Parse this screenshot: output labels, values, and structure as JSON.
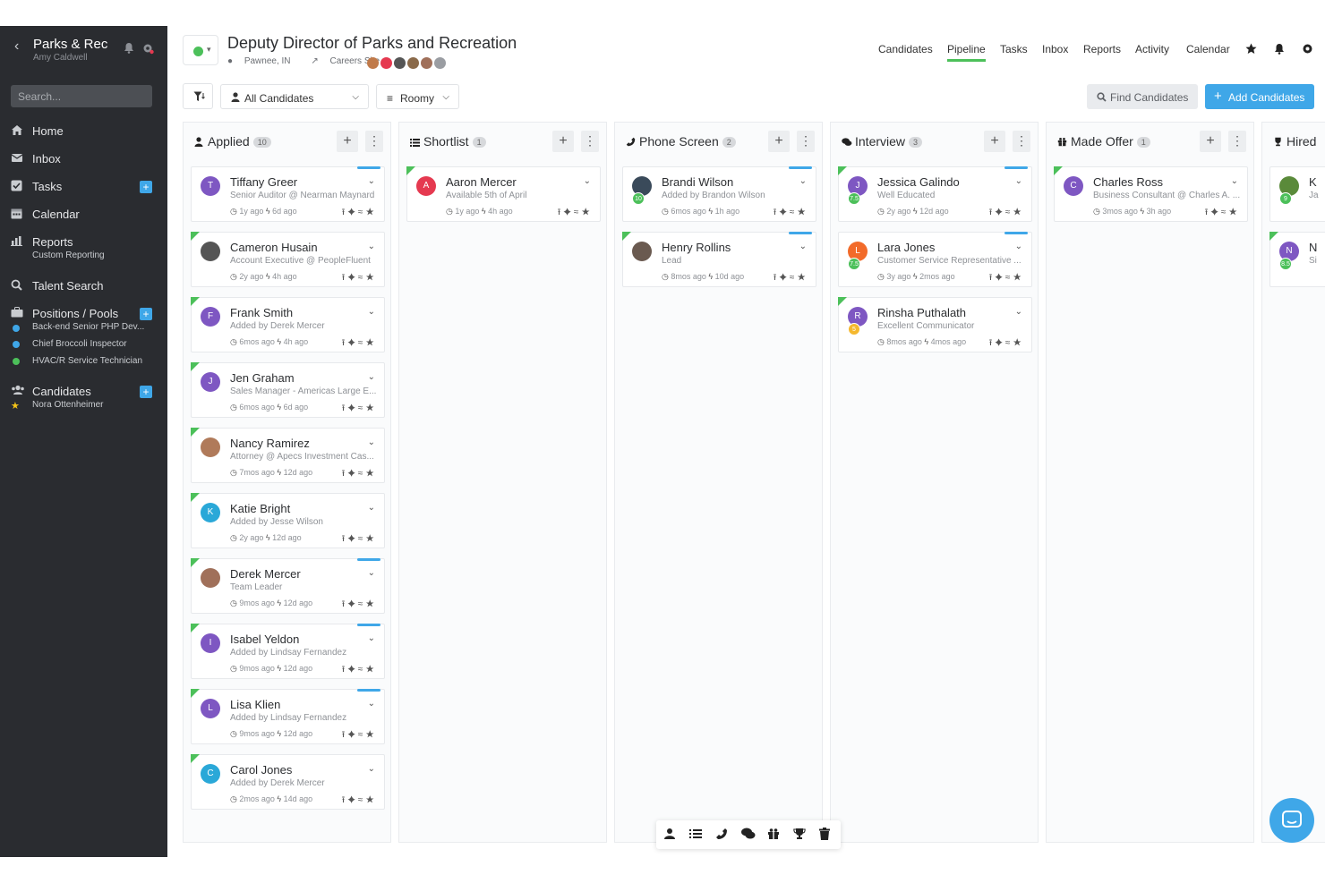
{
  "sidebar": {
    "org_name": "Parks & Rec",
    "user_name": "Amy Caldwell",
    "search_placeholder": "Search...",
    "items": [
      {
        "label": "Home",
        "icon": "home-icon"
      },
      {
        "label": "Inbox",
        "icon": "inbox-icon"
      },
      {
        "label": "Tasks",
        "icon": "tasks-icon"
      },
      {
        "label": "Calendar",
        "icon": "calendar-icon"
      },
      {
        "label": "Reports",
        "icon": "reports-icon"
      },
      {
        "label": "Talent Search",
        "icon": "search-icon"
      },
      {
        "label": "Positions / Pools",
        "icon": "briefcase-icon"
      },
      {
        "label": "Candidates",
        "icon": "users-icon"
      }
    ],
    "reports_sub": "Custom Reporting",
    "positions": [
      {
        "label": "Back-end Senior PHP Dev...",
        "color": "#3fa7e8"
      },
      {
        "label": "Chief Broccoli Inspector",
        "color": "#3fa7e8"
      },
      {
        "label": "HVAC/R Service Technician",
        "color": "#4cc05a"
      }
    ],
    "candidates_sub": "Nora Ottenheimer",
    "plus": "+"
  },
  "header": {
    "title": "Deputy Director of Parks and Recreation",
    "location": "Pawnee, IN",
    "careers_site": "Careers Site",
    "status_color": "#4cc05a",
    "nav": [
      "Candidates",
      "Pipeline",
      "Tasks",
      "Inbox",
      "Reports",
      "Activity",
      "Calendar"
    ],
    "active_nav": "Pipeline"
  },
  "toolbar": {
    "candidates_filter": "All Candidates",
    "view_mode": "Roomy",
    "find_label": "Find Candidates",
    "add_label": "Add Candidates"
  },
  "columns": [
    {
      "name": "Applied",
      "count": "10",
      "icon": "user-icon",
      "cards": [
        {
          "name": "Tiffany Greer",
          "sub": "Senior Auditor @ Nearman Maynard",
          "t1": "1y ago",
          "t2": "6d ago",
          "initial": "T",
          "color": "#7e57c2",
          "flag": false,
          "bar": true
        },
        {
          "name": "Cameron Husain",
          "sub": "Account Executive @ PeopleFluent",
          "t1": "2y ago",
          "t2": "4h ago",
          "initial": "",
          "color": "#555",
          "flag": true,
          "bar": false
        },
        {
          "name": "Frank Smith",
          "sub": "Added by Derek Mercer",
          "t1": "6mos ago",
          "t2": "4h ago",
          "initial": "F",
          "color": "#7e57c2",
          "flag": true,
          "bar": false
        },
        {
          "name": "Jen Graham",
          "sub": "Sales Manager - Americas Large E...",
          "t1": "6mos ago",
          "t2": "6d ago",
          "initial": "J",
          "color": "#7e57c2",
          "flag": true,
          "bar": false
        },
        {
          "name": "Nancy Ramirez",
          "sub": "Attorney @ Apecs Investment Cas...",
          "t1": "7mos ago",
          "t2": "12d ago",
          "initial": "",
          "color": "#b07a5a",
          "flag": true,
          "bar": false
        },
        {
          "name": "Katie Bright",
          "sub": "Added by Jesse Wilson",
          "t1": "2y ago",
          "t2": "12d ago",
          "initial": "K",
          "color": "#2aa8d8",
          "flag": true,
          "bar": false
        },
        {
          "name": "Derek Mercer",
          "sub": "Team Leader",
          "t1": "9mos ago",
          "t2": "12d ago",
          "initial": "",
          "color": "#a0705a",
          "flag": true,
          "bar": true
        },
        {
          "name": "Isabel Yeldon",
          "sub": "Added by Lindsay Fernandez",
          "t1": "9mos ago",
          "t2": "12d ago",
          "initial": "I",
          "color": "#7e57c2",
          "flag": true,
          "bar": true
        },
        {
          "name": "Lisa Klien",
          "sub": "Added by Lindsay Fernandez",
          "t1": "9mos ago",
          "t2": "12d ago",
          "initial": "L",
          "color": "#7e57c2",
          "flag": true,
          "bar": true
        },
        {
          "name": "Carol Jones",
          "sub": "Added by Derek Mercer",
          "t1": "2mos ago",
          "t2": "14d ago",
          "initial": "C",
          "color": "#2aa8d8",
          "flag": true,
          "bar": false
        }
      ]
    },
    {
      "name": "Shortlist",
      "count": "1",
      "icon": "list-icon",
      "cards": [
        {
          "name": "Aaron Mercer",
          "sub": "Available 5th of April",
          "t1": "1y ago",
          "t2": "4h ago",
          "initial": "A",
          "color": "#e53950",
          "flag": true,
          "bar": false
        }
      ]
    },
    {
      "name": "Phone Screen",
      "count": "2",
      "icon": "phone-icon",
      "cards": [
        {
          "name": "Brandi Wilson",
          "sub": "Added by Brandon Wilson",
          "t1": "6mos ago",
          "t2": "1h ago",
          "initial": "",
          "color": "#3a4a5a",
          "flag": false,
          "bar": true,
          "score": "10"
        },
        {
          "name": "Henry Rollins",
          "sub": "Lead",
          "t1": "8mos ago",
          "t2": "10d ago",
          "initial": "",
          "color": "#6a5a50",
          "flag": true,
          "bar": true
        }
      ]
    },
    {
      "name": "Interview",
      "count": "3",
      "icon": "comments-icon",
      "cards": [
        {
          "name": "Jessica Galindo",
          "sub": "Well Educated",
          "t1": "2y ago",
          "t2": "12d ago",
          "initial": "J",
          "color": "#7e57c2",
          "flag": true,
          "bar": true,
          "score": "7.5"
        },
        {
          "name": "Lara Jones",
          "sub": "Customer Service Representative ...",
          "t1": "3y ago",
          "t2": "2mos ago",
          "initial": "L",
          "color": "#f26b2a",
          "flag": false,
          "bar": true,
          "score": "7.5"
        },
        {
          "name": "Rinsha Puthalath",
          "sub": "Excellent Communicator",
          "t1": "8mos ago",
          "t2": "4mos ago",
          "initial": "R",
          "color": "#7e57c2",
          "flag": true,
          "bar": false,
          "score": "5"
        }
      ]
    },
    {
      "name": "Made Offer",
      "count": "1",
      "icon": "gift-icon",
      "cards": [
        {
          "name": "Charles Ross",
          "sub": "Business Consultant @ Charles A. ...",
          "t1": "3mos ago",
          "t2": "3h ago",
          "initial": "C",
          "color": "#7e57c2",
          "flag": true,
          "bar": false
        }
      ]
    },
    {
      "name": "Hired",
      "count": "",
      "icon": "trophy-icon",
      "cards": [
        {
          "name": "K",
          "sub": "Ja",
          "t1": "",
          "t2": "",
          "initial": "",
          "color": "#5a8a3a",
          "flag": false,
          "bar": false,
          "score": "9"
        },
        {
          "name": "N",
          "sub": "Si",
          "t1": "",
          "t2": "",
          "initial": "N",
          "color": "#7e57c2",
          "flag": true,
          "bar": false,
          "score": "8.5"
        }
      ]
    }
  ]
}
